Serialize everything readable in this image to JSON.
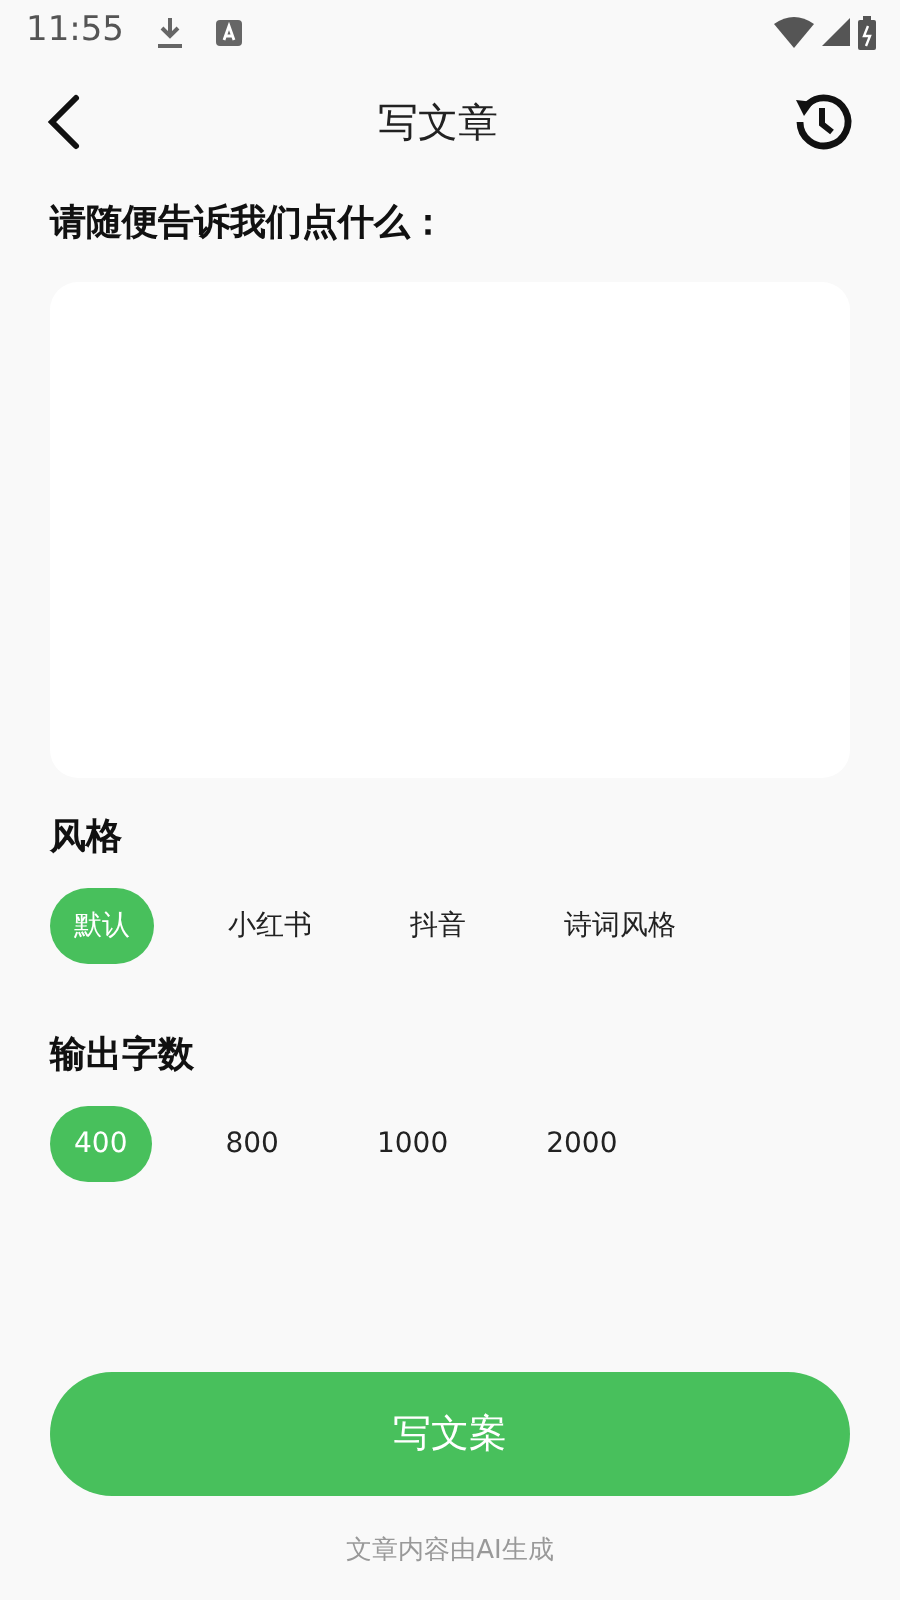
{
  "status_bar": {
    "time": "11:55"
  },
  "header": {
    "title": "写文章"
  },
  "prompt": {
    "label": "请随便告诉我们点什么："
  },
  "style": {
    "label": "风格",
    "options": [
      {
        "label": "默认",
        "selected": true
      },
      {
        "label": "小红书",
        "selected": false
      },
      {
        "label": "抖音",
        "selected": false
      },
      {
        "label": "诗词风格",
        "selected": false
      }
    ]
  },
  "length": {
    "label": "输出字数",
    "options": [
      {
        "label": "400",
        "selected": true
      },
      {
        "label": "800",
        "selected": false
      },
      {
        "label": "1000",
        "selected": false
      },
      {
        "label": "2000",
        "selected": false
      }
    ]
  },
  "submit": {
    "label": "写文案"
  },
  "footer": {
    "note": "文章内容由AI生成"
  }
}
